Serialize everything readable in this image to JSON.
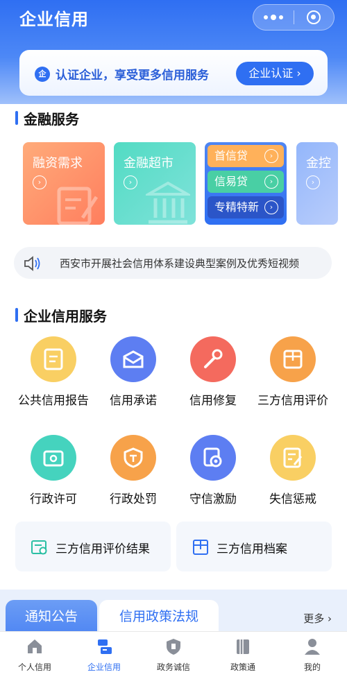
{
  "header": {
    "title": "企业信用"
  },
  "cert": {
    "badge": "企",
    "text": "认证企业，享受更多信用服务",
    "button": "企业认证 ›"
  },
  "finance": {
    "title": "金融服务",
    "cards": [
      {
        "label": "融资需求"
      },
      {
        "label": "金融超市"
      },
      {
        "label": "金控"
      }
    ],
    "loans": [
      "首信贷",
      "信易贷",
      "专精特新"
    ]
  },
  "notice": {
    "text": "西安市开展社会信用体系建设典型案例及优秀短视频"
  },
  "credit": {
    "title": "企业信用服务",
    "items": [
      {
        "label": "公共信用报告",
        "icon": "report-icon",
        "color": "#f9cf63"
      },
      {
        "label": "信用承诺",
        "icon": "envelope-icon",
        "color": "#5d7ef2"
      },
      {
        "label": "信用修复",
        "icon": "wrench-icon",
        "color": "#f46a5e"
      },
      {
        "label": "三方信用评价",
        "icon": "box-icon",
        "color": "#f7a24a"
      },
      {
        "label": "行政许可",
        "icon": "license-icon",
        "color": "#45d3be"
      },
      {
        "label": "行政处罚",
        "icon": "shield-icon",
        "color": "#f7a24a"
      },
      {
        "label": "守信激励",
        "icon": "medal-icon",
        "color": "#5d7ef2"
      },
      {
        "label": "失信惩戒",
        "icon": "doc-edit-icon",
        "color": "#f9cf63"
      }
    ],
    "tiles": [
      {
        "label": "三方信用评价结果"
      },
      {
        "label": "三方信用档案"
      }
    ]
  },
  "news": {
    "tab_active": "通知公告",
    "tab_inactive": "信用政策法规",
    "more": "更多 ›"
  },
  "tabbar": {
    "items": [
      {
        "label": "个人信用"
      },
      {
        "label": "企业信用"
      },
      {
        "label": "政务诚信"
      },
      {
        "label": "政策通"
      },
      {
        "label": "我的"
      }
    ]
  }
}
